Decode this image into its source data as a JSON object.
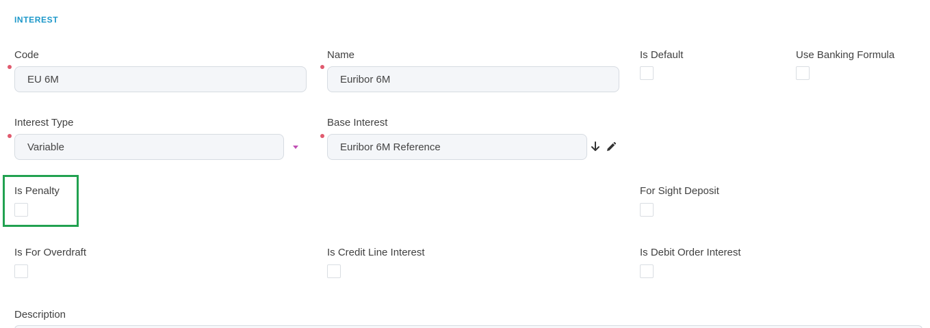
{
  "section": {
    "title": "INTEREST"
  },
  "fields": {
    "code": {
      "label": "Code",
      "value": "EU 6M"
    },
    "name": {
      "label": "Name",
      "value": "Euribor 6M"
    },
    "is_default": {
      "label": "Is Default",
      "checked": false
    },
    "use_banking_formula": {
      "label": "Use Banking Formula",
      "checked": false
    },
    "interest_type": {
      "label": "Interest Type",
      "value": "Variable"
    },
    "base_interest": {
      "label": "Base Interest",
      "value": "Euribor 6M Reference"
    },
    "is_penalty": {
      "label": "Is Penalty",
      "checked": false
    },
    "for_sight_deposit": {
      "label": "For Sight Deposit",
      "checked": false
    },
    "is_for_overdraft": {
      "label": "Is For Overdraft",
      "checked": false
    },
    "is_credit_line_interest": {
      "label": "Is Credit Line Interest",
      "checked": false
    },
    "is_debit_order_interest": {
      "label": "Is Debit Order Interest",
      "checked": false
    },
    "description": {
      "label": "Description",
      "value": ""
    }
  },
  "colors": {
    "accent": "#1b97c9",
    "required_marker": "#e05a6e",
    "dropdown_caret": "#c04fb4",
    "highlight": "#21a150"
  },
  "icons": {
    "dropdown": "caret-down-icon",
    "base_interest_actions": [
      "arrow-down-icon",
      "pencil-icon"
    ]
  }
}
